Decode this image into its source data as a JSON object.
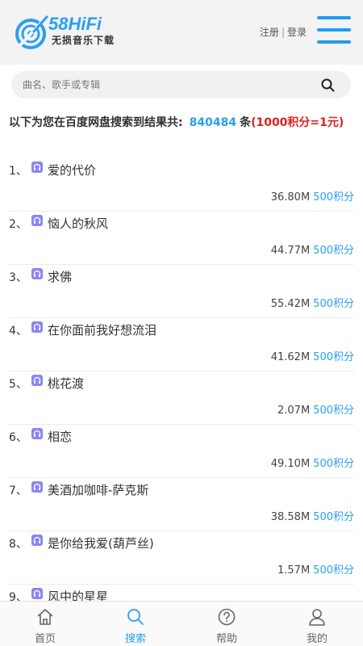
{
  "header": {
    "logo_title": "58HiFi",
    "logo_subtitle": "无损音乐下载",
    "register_label": "注册",
    "auth_separator": "|",
    "login_label": "登录",
    "menu_icon": "hamburger-menu-icon"
  },
  "search": {
    "placeholder": "曲名、歌手或专辑",
    "value": "",
    "icon": "search-icon"
  },
  "summary": {
    "prefix": "以下为您在百度网盘搜索到结果共:",
    "count": "840484",
    "unit": "条",
    "price_note": "(1000积分=1元)"
  },
  "results": [
    {
      "index": "1、",
      "name": "爱的代价",
      "size": "36.80M",
      "points": "500积分"
    },
    {
      "index": "2、",
      "name": "恼人的秋风",
      "size": "44.77M",
      "points": "500积分"
    },
    {
      "index": "3、",
      "name": "求佛",
      "size": "55.42M",
      "points": "500积分"
    },
    {
      "index": "4、",
      "name": "在你面前我好想流泪",
      "size": "41.62M",
      "points": "500积分"
    },
    {
      "index": "5、",
      "name": "桃花渡",
      "size": "2.07M",
      "points": "500积分"
    },
    {
      "index": "6、",
      "name": "相恋",
      "size": "49.10M",
      "points": "500积分"
    },
    {
      "index": "7、",
      "name": "美酒加咖啡-萨克斯",
      "size": "38.58M",
      "points": "500积分"
    },
    {
      "index": "8、",
      "name": "是你给我爱(葫芦丝)",
      "size": "1.57M",
      "points": "500积分"
    },
    {
      "index": "9、",
      "name": "风中的星星",
      "size": "",
      "points": ""
    }
  ],
  "bottom_nav": [
    {
      "label": "首页",
      "icon": "home-icon",
      "active": false
    },
    {
      "label": "搜索",
      "icon": "search-icon",
      "active": true
    },
    {
      "label": "帮助",
      "icon": "help-icon",
      "active": false
    },
    {
      "label": "我的",
      "icon": "user-icon",
      "active": false
    }
  ],
  "colors": {
    "accent": "#2a9ff0",
    "price_red": "#e02020",
    "song_icon": "#8a86f0"
  }
}
